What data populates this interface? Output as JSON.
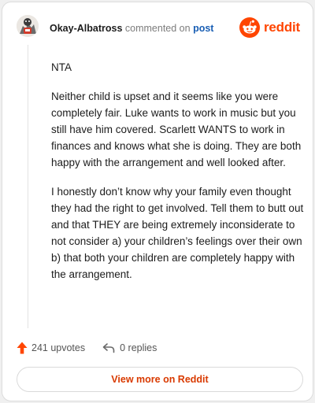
{
  "header": {
    "username": "Okay-Albatross",
    "action_text": "commented on",
    "post_link": "post",
    "brand_name": "reddit"
  },
  "comment": {
    "paragraphs": [
      "NTA",
      "Neither child is upset and it seems like you were completely fair. Luke wants to work in music but you still have him covered. Scarlett WANTS to work in finances and knows what she is doing. They are both happy with the arrangement and well looked after.",
      "I honestly don’t know why your family even thought they had the right to get involved. Tell them to butt out and that THEY are being extremely inconsiderate to not consider a) your children’s feelings over their own b) that both your children are completely happy with the arrangement."
    ]
  },
  "footer": {
    "upvotes": "241 upvotes",
    "replies": "0 replies",
    "view_more_label": "View more on Reddit"
  },
  "colors": {
    "brand": "#ff4500",
    "upvote": "#ff4500",
    "link": "#1a5fb4",
    "view_more_text": "#d93a00"
  },
  "icons": {
    "avatar": "user-avatar",
    "brand_logo": "reddit-snoo-icon",
    "upvote": "upvote-arrow-icon",
    "reply": "reply-arrow-icon"
  }
}
